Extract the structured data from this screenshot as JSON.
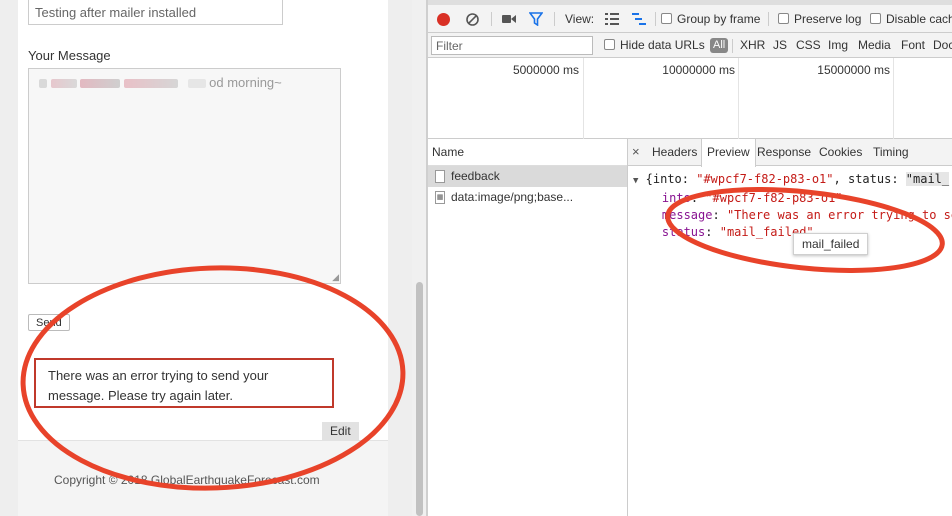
{
  "form": {
    "subject_value": "Testing after mailer installed",
    "message_label": "Your Message",
    "message_visible_text": "od morning~",
    "send_label": "Send",
    "error_message": "There was an error trying to send your message. Please try again later.",
    "edit_label": "Edit",
    "copyright": "Copyright © 2018 GlobalEarthquakeForecast.com"
  },
  "devtools": {
    "toolbar": {
      "view_label": "View:",
      "group_by_frame": "Group by frame",
      "preserve_log": "Preserve log",
      "disable_cache": "Disable cach"
    },
    "filterbar": {
      "filter_placeholder": "Filter",
      "hide_data_urls": "Hide data URLs",
      "all_label": "All",
      "types": [
        "XHR",
        "JS",
        "CSS",
        "Img",
        "Media",
        "Font",
        "Doc"
      ]
    },
    "timeline_labels": [
      "5000000 ms",
      "10000000 ms",
      "15000000 ms"
    ],
    "name_header": "Name",
    "requests": [
      {
        "name": "feedback"
      },
      {
        "name": "data:image/png;base..."
      }
    ],
    "tabs": {
      "close": "×",
      "headers": "Headers",
      "preview": "Preview",
      "response": "Response",
      "cookies": "Cookies",
      "timing": "Timing"
    },
    "preview": {
      "summary_open": "{into: ",
      "summary_into": "\"#wpcf7-f82-p83-o1\"",
      "summary_mid": ", status: ",
      "summary_status": "\"mail_",
      "into_key": "into",
      "into_value": "\"#wpcf7-f82-p83-o1\"",
      "message_key": "message",
      "message_value": "\"There was an error trying to se",
      "status_key": "status",
      "status_value": "\"mail_failed\""
    },
    "tooltip": "mail_failed"
  },
  "annotation_color": "#e8432a"
}
